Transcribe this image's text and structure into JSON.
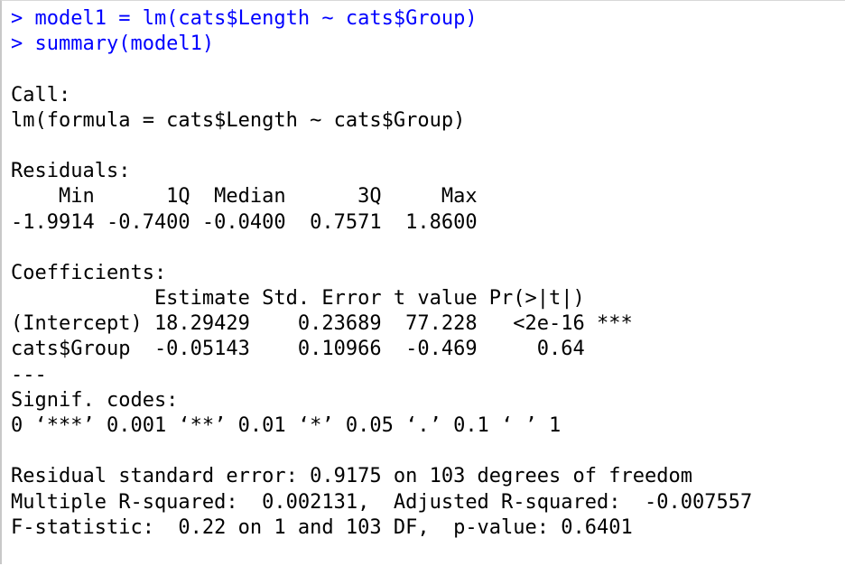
{
  "console": {
    "commands": [
      "> model1 = lm(cats$Length ~ cats$Group)",
      "> summary(model1)"
    ],
    "output": [
      "",
      "Call:",
      "lm(formula = cats$Length ~ cats$Group)",
      "",
      "Residuals:",
      "    Min      1Q  Median      3Q     Max ",
      "-1.9914 -0.7400 -0.0400  0.7571  1.8600 ",
      "",
      "Coefficients:",
      "            Estimate Std. Error t value Pr(>|t|)    ",
      "(Intercept) 18.29429    0.23689  77.228   <2e-16 ***",
      "cats$Group  -0.05143    0.10966  -0.469     0.64    ",
      "---",
      "Signif. codes:  ",
      "0 ‘***’ 0.001 ‘**’ 0.01 ‘*’ 0.05 ‘.’ 0.1 ‘ ’ 1",
      "",
      "Residual standard error: 0.9175 on 103 degrees of freedom",
      "Multiple R-squared:  0.002131,\tAdjusted R-squared:  -0.007557 ",
      "F-statistic:  0.22 on 1 and 103 DF,  p-value: 0.6401",
      ""
    ]
  },
  "colors": {
    "command": "#0000ff",
    "output": "#000000",
    "background": "#ffffff"
  }
}
